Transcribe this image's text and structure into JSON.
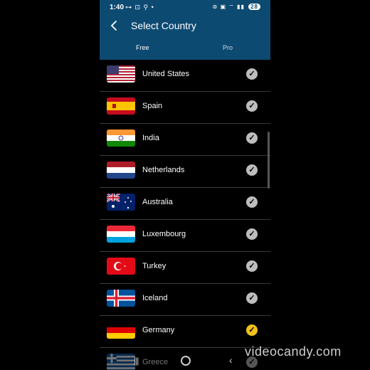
{
  "status": {
    "time": "1:40",
    "left_icons": "⊶ ⊡ ⚲ •",
    "right_icons": "⊚ ▣ ⌔ ▮▮",
    "battery": "28"
  },
  "header": {
    "title": "Select Country"
  },
  "tabs": [
    {
      "label": "Free"
    },
    {
      "label": "Pro"
    }
  ],
  "countries": [
    {
      "name": "United States",
      "flag": "us-flag",
      "selected": false
    },
    {
      "name": "Spain",
      "flag": "spain-flag",
      "selected": false
    },
    {
      "name": "India",
      "flag": "india-flag",
      "selected": false
    },
    {
      "name": "Netherlands",
      "flag": "netherlands-flag",
      "selected": false
    },
    {
      "name": "Australia",
      "flag": "australia-flag",
      "selected": false
    },
    {
      "name": "Luxembourg",
      "flag": "luxembourg-flag",
      "selected": false
    },
    {
      "name": "Turkey",
      "flag": "turkey-flag",
      "selected": false
    },
    {
      "name": "Iceland",
      "flag": "iceland-flag",
      "selected": false
    },
    {
      "name": "Germany",
      "flag": "germany-flag",
      "selected": true
    },
    {
      "name": "Greece",
      "flag": "greece-flag",
      "selected": false
    }
  ],
  "colors": {
    "appbar": "#0d4a72",
    "selected_check": "#f2c21a",
    "check": "#bdbdbd"
  },
  "watermark": "videocandy.com"
}
